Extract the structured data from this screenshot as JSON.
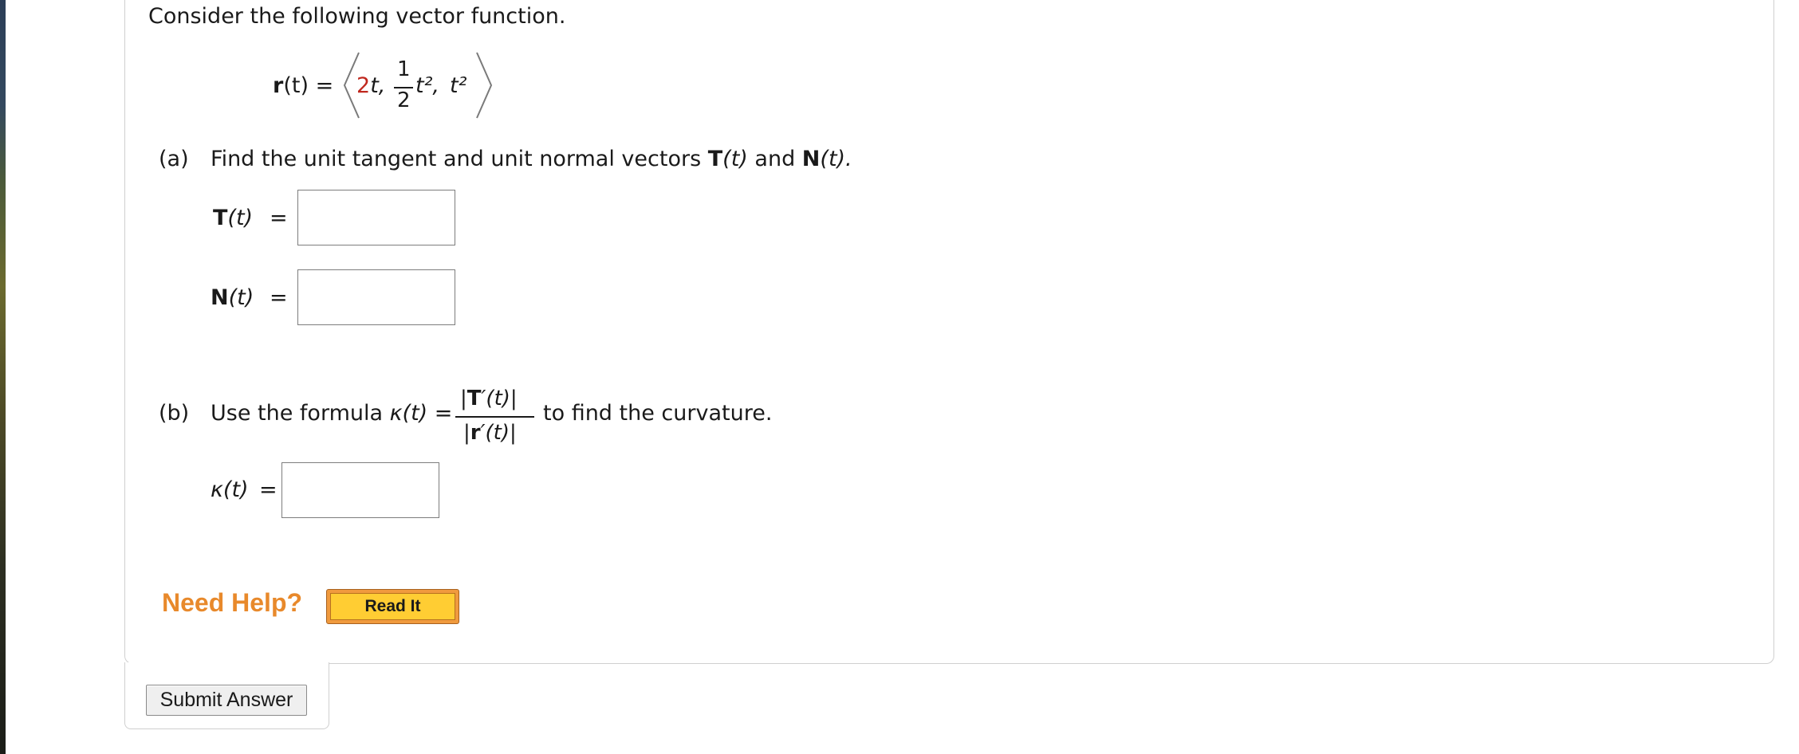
{
  "question": {
    "intro": "Consider the following vector function.",
    "vector_function": {
      "lhs_bold": "r",
      "lhs_arg": "(t)",
      "equals": "=",
      "component1": "2",
      "component1_var": "t,",
      "component2_num": "1",
      "component2_den": "2",
      "component2_tail": "t²,",
      "component3": "t²"
    },
    "part_a": {
      "label": "(a)",
      "text_before": "Find the unit tangent and unit normal vectors",
      "T_symbol": "T",
      "T_arg": "(t)",
      "and": "and",
      "N_symbol": "N",
      "N_arg": "(t).",
      "T_row_label": "T",
      "T_row_arg": "(t)",
      "N_row_label": "N",
      "N_row_arg": "(t)",
      "equals": "=",
      "T_value": "",
      "N_value": ""
    },
    "part_b": {
      "label": "(b)",
      "text_before": "Use the formula",
      "kappa": "κ(t)",
      "equals": "=",
      "numerator_bar_open": "|",
      "numerator_bold": "T",
      "numerator_rest": "′(t)|",
      "denominator_bar_open": "|",
      "denominator_bold": "r",
      "denominator_rest": "′(t)|",
      "text_after": "to find the curvature.",
      "kappa_row_label": "κ(t)",
      "kappa_value": ""
    }
  },
  "help": {
    "need_help": "Need Help?",
    "read_it": "Read It"
  },
  "submit": {
    "label": "Submit Answer"
  },
  "colors": {
    "accent_orange": "#e8892b",
    "read_it_fill": "#ffcd33",
    "highlight_red": "#c0281e"
  }
}
